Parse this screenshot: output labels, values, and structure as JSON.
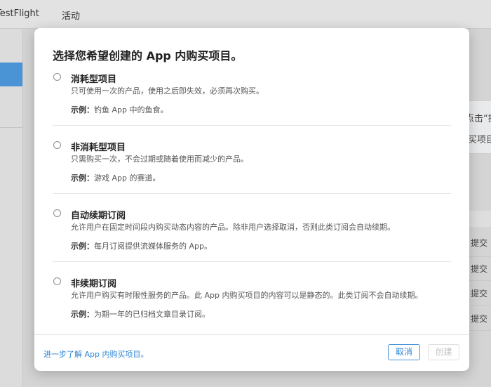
{
  "background": {
    "nav_tabs": [
      "TestFlight",
      "活动"
    ],
    "right_panel_texts": [
      "点击“提",
      "买项目"
    ],
    "row_status": [
      "提交",
      "提交",
      "提交",
      "提交"
    ]
  },
  "modal": {
    "title": "选择您希望创建的 App 内购买项目。",
    "example_label": "示例：",
    "options": [
      {
        "title": "消耗型项目",
        "description": "只可使用一次的产品，使用之后即失效，必须再次购买。",
        "example": "钓鱼 App 中的鱼食。"
      },
      {
        "title": "非消耗型项目",
        "description": "只需购买一次，不会过期或随着使用而减少的产品。",
        "example": "游戏 App 的赛道。"
      },
      {
        "title": "自动续期订阅",
        "description": "允许用户在固定时间段内购买动态内容的产品。除非用户选择取消，否则此类订阅会自动续期。",
        "example": "每月订阅提供流媒体服务的 App。"
      },
      {
        "title": "非续期订阅",
        "description": "允许用户购买有时限性服务的产品。此 App 内购买项目的内容可以是静态的。此类订阅不会自动续期。",
        "example": "为期一年的已归档文章目录订阅。"
      }
    ],
    "learn_more_link": "进一步了解 App 内购买项目。",
    "cancel_label": "取消",
    "create_label": "创建"
  },
  "colors": {
    "accent": "#2f86d6",
    "sidebar_active": "#4a94d6",
    "disabled_text": "#bfbfbf"
  }
}
